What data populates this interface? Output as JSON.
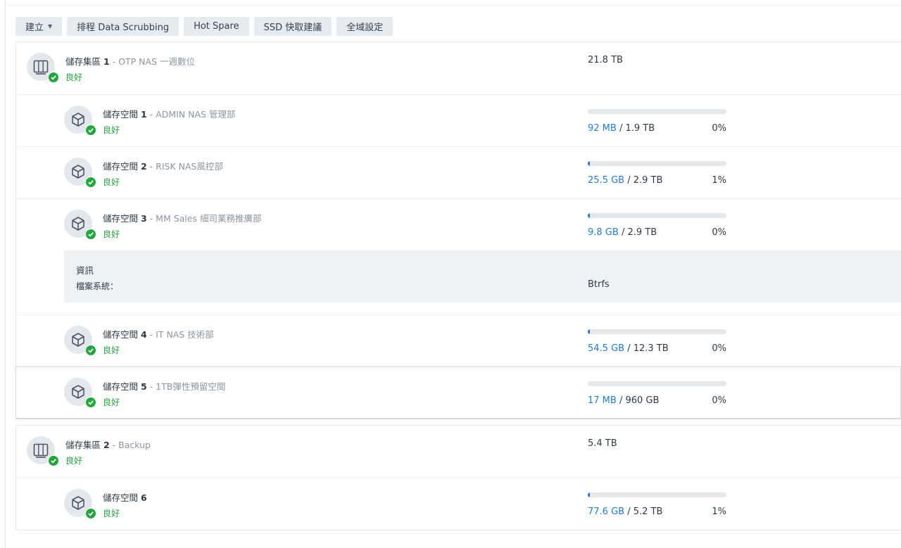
{
  "toolbar": {
    "create_label": "建立",
    "scrubbing_label": "排程 Data Scrubbing",
    "hotspare_label": "Hot Spare",
    "ssd_label": "SSD 快取建議",
    "global_label": "全域設定"
  },
  "pools": [
    {
      "name": "儲存集區",
      "num": "1",
      "desc": " - OTP NAS 一週數位",
      "status": "良好",
      "size": "21.8 TB",
      "volumes": [
        {
          "name": "儲存空間",
          "num": "1",
          "desc": " - ADMIN NAS 管理部",
          "status": "良好",
          "used": "92 MB",
          "total": " / 1.9 TB",
          "percent": "0%",
          "fill": 0.0
        },
        {
          "name": "儲存空間",
          "num": "2",
          "desc": " - RISK NAS風控部",
          "status": "良好",
          "used": "25.5 GB",
          "total": " / 2.9 TB",
          "percent": "1%",
          "fill": 0.01
        },
        {
          "name": "儲存空間",
          "num": "3",
          "desc": " - MM Sales 細司業務推廣部",
          "status": "良好",
          "used": "9.8 GB",
          "total": " / 2.9 TB",
          "percent": "0%",
          "fill": 0.0034
        },
        {
          "name": "儲存空間",
          "num": "4",
          "desc": " - IT NAS 技術部",
          "status": "良好",
          "used": "54.5 GB",
          "total": " / 12.3 TB",
          "percent": "0%",
          "fill": 0.0044
        },
        {
          "name": "儲存空間",
          "num": "5",
          "desc": " - 1TB彈性預留空間",
          "status": "良好",
          "used": "17 MB",
          "total": " / 960 GB",
          "percent": "0%",
          "fill": 0.0
        }
      ],
      "info": {
        "title": "資訊",
        "fs_key": "檔案系統：",
        "fs_value": "Btrfs"
      }
    },
    {
      "name": "儲存集區",
      "num": "2",
      "desc": " - Backup",
      "status": "良好",
      "size": "5.4 TB",
      "volumes": [
        {
          "name": "儲存空間",
          "num": "6",
          "desc": "",
          "status": "良好",
          "used": "77.6 GB",
          "total": " / 5.2 TB",
          "percent": "1%",
          "fill": 0.0146
        }
      ]
    }
  ],
  "colors": {
    "accent": "#1f7dd6",
    "healthy": "#21a73b",
    "info_bg": "#eef2f5",
    "button_bg": "#e6ebf0"
  },
  "icons": {
    "pool": "nas-drive-icon",
    "volume": "cube-icon",
    "status": "check-badge-icon",
    "dropdown": "caret-down-icon"
  }
}
